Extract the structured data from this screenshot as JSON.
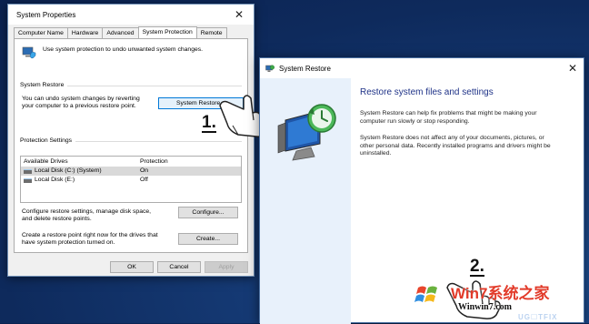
{
  "system_properties": {
    "title": "System Properties",
    "tabs": [
      "Computer Name",
      "Hardware",
      "Advanced",
      "System Protection",
      "Remote"
    ],
    "intro": "Use system protection to undo unwanted system changes.",
    "restore_group": {
      "label": "System Restore",
      "text_line1": "You can undo system changes by reverting",
      "text_line2": "your computer to a previous restore point.",
      "button": "System Restore..."
    },
    "protection_group": {
      "label": "Protection Settings",
      "columns": [
        "Available Drives",
        "Protection"
      ],
      "rows": [
        {
          "drive": "Local Disk (C:) (System)",
          "protection": "On"
        },
        {
          "drive": "Local Disk (E:)",
          "protection": "Off"
        }
      ],
      "configure_text_line1": "Configure restore settings, manage disk space,",
      "configure_text_line2": "and delete restore points.",
      "configure_button": "Configure...",
      "create_text_line1": "Create a restore point right now for the drives that",
      "create_text_line2": "have system protection turned on.",
      "create_button": "Create..."
    },
    "ok_button": "OK",
    "cancel_button": "Cancel",
    "apply_button": "Apply"
  },
  "system_restore": {
    "title": "System Restore",
    "heading": "Restore system files and settings",
    "para1_line1": "System Restore can help fix problems that might be making your",
    "para1_line2": "computer run slowly or stop responding.",
    "para2_line1": "System Restore does not affect any of your documents, pictures, or",
    "para2_line2": "other personal data. Recently installed programs and drivers might be",
    "para2_line3": "uninstalled."
  },
  "annotations": {
    "step1": "1.",
    "step2": "2."
  },
  "watermark": {
    "brand": "Win7系统之家",
    "url": "Winwin7.com",
    "corner": "UG☐TFIX"
  },
  "colors": {
    "heading_blue": "#1e3287",
    "desktop_blue": "#163c78",
    "focus_blue": "#0078d7"
  }
}
